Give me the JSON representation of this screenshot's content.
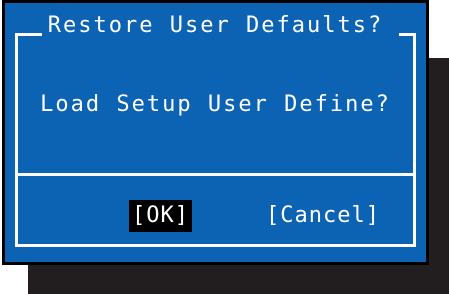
{
  "dialog": {
    "title": "Restore User Defaults?",
    "message": "Load Setup User Define?",
    "buttons": {
      "ok_label": "[OK]",
      "cancel_label": "[Cancel]"
    },
    "selected_button": "ok"
  },
  "colors": {
    "dialog_background": "#0c62b3",
    "text": "#ffffff",
    "selected_button_background": "#000000",
    "shadow": "#221d1e"
  }
}
